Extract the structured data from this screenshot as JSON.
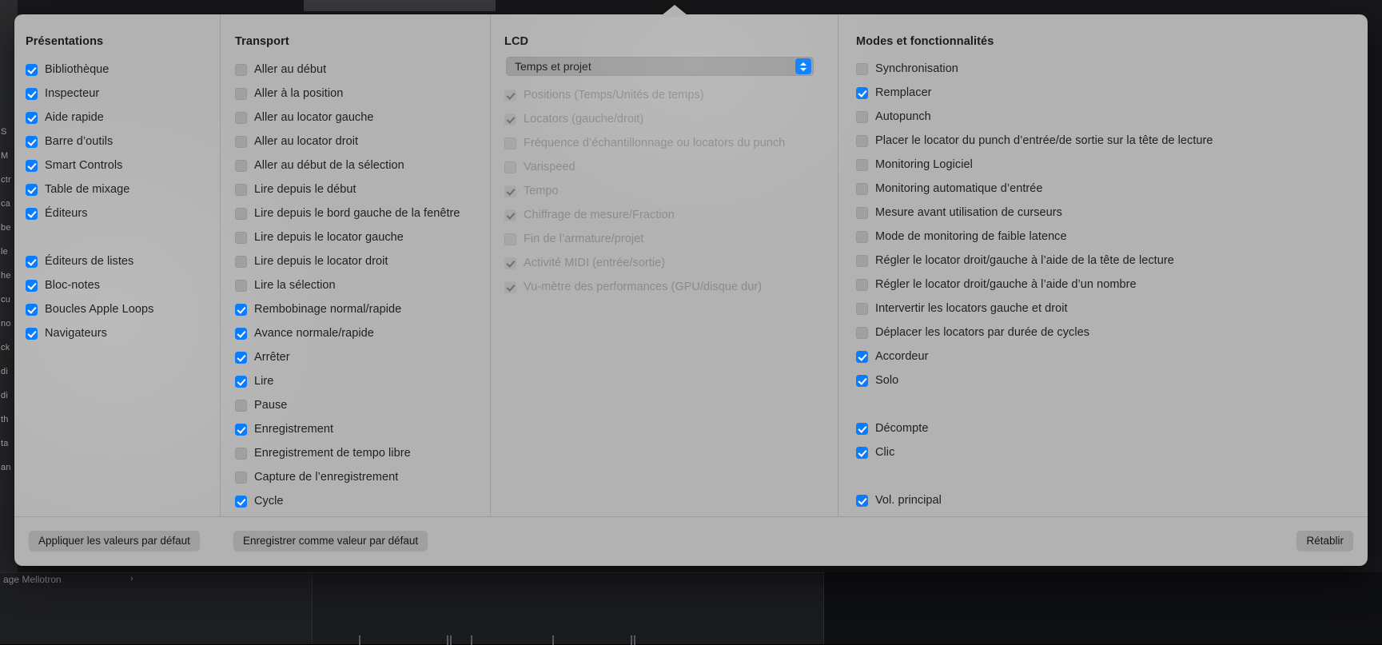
{
  "background": {
    "left_strip_labels": [
      "S",
      "M",
      "ctr",
      "ca",
      "be",
      "le",
      "he",
      "cu",
      "no",
      "ck",
      "di",
      "di",
      "th",
      "ta",
      "an"
    ],
    "bottom_track_label": "age Mellotron",
    "bottom_track_arrow": "›"
  },
  "popover": {
    "columns": [
      {
        "id": "presentations",
        "title": "Présentations",
        "items": [
          {
            "label": "Bibliothèque",
            "checked": true,
            "disabled": false
          },
          {
            "label": "Inspecteur",
            "checked": true,
            "disabled": false
          },
          {
            "label": "Aide rapide",
            "checked": true,
            "disabled": false
          },
          {
            "label": "Barre d’outils",
            "checked": true,
            "disabled": false
          },
          {
            "label": "Smart Controls",
            "checked": true,
            "disabled": false
          },
          {
            "label": "Table de mixage",
            "checked": true,
            "disabled": false
          },
          {
            "label": "Éditeurs",
            "checked": true,
            "disabled": false
          },
          {
            "spacer": true
          },
          {
            "label": "Éditeurs de listes",
            "checked": true,
            "disabled": false
          },
          {
            "label": "Bloc-notes",
            "checked": true,
            "disabled": false
          },
          {
            "label": "Boucles Apple Loops",
            "checked": true,
            "disabled": false
          },
          {
            "label": "Navigateurs",
            "checked": true,
            "disabled": false
          }
        ]
      },
      {
        "id": "transport",
        "title": "Transport",
        "items": [
          {
            "label": "Aller au début",
            "checked": false,
            "disabled": false
          },
          {
            "label": "Aller à la position",
            "checked": false,
            "disabled": false
          },
          {
            "label": "Aller au locator gauche",
            "checked": false,
            "disabled": false
          },
          {
            "label": "Aller au locator droit",
            "checked": false,
            "disabled": false
          },
          {
            "label": "Aller au début de la sélection",
            "checked": false,
            "disabled": false
          },
          {
            "label": "Lire depuis le début",
            "checked": false,
            "disabled": false
          },
          {
            "label": "Lire depuis le bord gauche de la fenêtre",
            "checked": false,
            "disabled": false
          },
          {
            "label": "Lire depuis le locator gauche",
            "checked": false,
            "disabled": false
          },
          {
            "label": "Lire depuis le locator droit",
            "checked": false,
            "disabled": false
          },
          {
            "label": "Lire la sélection",
            "checked": false,
            "disabled": false
          },
          {
            "label": "Rembobinage normal/rapide",
            "checked": true,
            "disabled": false
          },
          {
            "label": "Avance normale/rapide",
            "checked": true,
            "disabled": false
          },
          {
            "label": "Arrêter",
            "checked": true,
            "disabled": false
          },
          {
            "label": "Lire",
            "checked": true,
            "disabled": false
          },
          {
            "label": "Pause",
            "checked": false,
            "disabled": false
          },
          {
            "label": "Enregistrement",
            "checked": true,
            "disabled": false
          },
          {
            "label": "Enregistrement de tempo libre",
            "checked": false,
            "disabled": false
          },
          {
            "label": "Capture de l’enregistrement",
            "checked": false,
            "disabled": false
          },
          {
            "label": "Cycle",
            "checked": true,
            "disabled": false
          }
        ]
      },
      {
        "id": "lcd",
        "title": "LCD",
        "popup": {
          "value": "Temps et projet"
        },
        "items": [
          {
            "label": "Positions (Temps/Unités de temps)",
            "checked": true,
            "disabled": true
          },
          {
            "label": "Locators (gauche/droit)",
            "checked": true,
            "disabled": true
          },
          {
            "label": "Fréquence d’échantillonnage ou locators du punch",
            "checked": false,
            "disabled": true
          },
          {
            "label": "Varispeed",
            "checked": false,
            "disabled": true
          },
          {
            "label": "Tempo",
            "checked": true,
            "disabled": true
          },
          {
            "label": "Chiffrage de mesure/Fraction",
            "checked": true,
            "disabled": true
          },
          {
            "label": "Fin de l’armature/projet",
            "checked": false,
            "disabled": true
          },
          {
            "label": "Activité MIDI (entrée/sortie)",
            "checked": true,
            "disabled": true
          },
          {
            "label": "Vu-mètre des performances (GPU/disque dur)",
            "checked": true,
            "disabled": true
          }
        ]
      },
      {
        "id": "modes",
        "title": "Modes et fonctionnalités",
        "items": [
          {
            "label": "Synchronisation",
            "checked": false,
            "disabled": false
          },
          {
            "label": "Remplacer",
            "checked": true,
            "disabled": false
          },
          {
            "label": "Autopunch",
            "checked": false,
            "disabled": false
          },
          {
            "label": "Placer le locator du punch d’entrée/de sortie sur la tête de lecture",
            "checked": false,
            "disabled": false
          },
          {
            "label": "Monitoring Logiciel",
            "checked": false,
            "disabled": false
          },
          {
            "label": "Monitoring automatique d’entrée",
            "checked": false,
            "disabled": false
          },
          {
            "label": "Mesure avant utilisation de curseurs",
            "checked": false,
            "disabled": false
          },
          {
            "label": "Mode de monitoring de faible latence",
            "checked": false,
            "disabled": false
          },
          {
            "label": "Régler le locator droit/gauche à l’aide de la tête de lecture",
            "checked": false,
            "disabled": false
          },
          {
            "label": "Régler le locator droit/gauche à l’aide d’un nombre",
            "checked": false,
            "disabled": false
          },
          {
            "label": "Intervertir les locators gauche et droit",
            "checked": false,
            "disabled": false
          },
          {
            "label": "Déplacer les locators par durée de cycles",
            "checked": false,
            "disabled": false
          },
          {
            "label": "Accordeur",
            "checked": true,
            "disabled": false
          },
          {
            "label": "Solo",
            "checked": true,
            "disabled": false
          },
          {
            "spacer": true
          },
          {
            "label": "Décompte",
            "checked": true,
            "disabled": false
          },
          {
            "label": "Clic",
            "checked": true,
            "disabled": false
          },
          {
            "spacer": true
          },
          {
            "label": "Vol. principal",
            "checked": true,
            "disabled": false
          }
        ]
      }
    ],
    "footer": {
      "apply_defaults": "Appliquer les valeurs par défaut",
      "save_as_default": "Enregistrer comme valeur par défaut",
      "reset": "Rétablir"
    }
  },
  "colors": {
    "accent": "#0a7cff",
    "popover_bg": "#b2b2b2",
    "checkbox_off": "#a0a0a0",
    "divider": "#9d9d9d",
    "button_bg": "#9f9f9f",
    "text": "#1f1f1f",
    "text_disabled": "#8b8b8b"
  }
}
